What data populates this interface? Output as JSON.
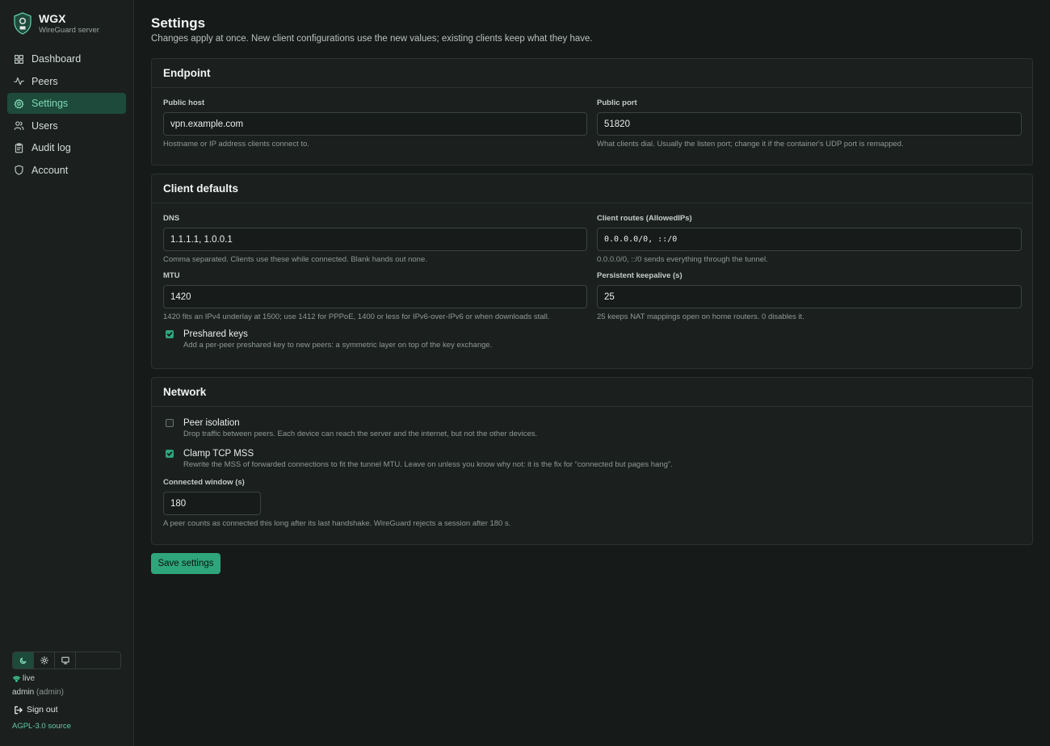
{
  "brand": {
    "name": "WGX",
    "subtitle": "WireGuard server",
    "logo_icon": "shield-lock-icon"
  },
  "sidebar": {
    "items": [
      {
        "label": "Dashboard",
        "icon": "grid-icon",
        "active": false
      },
      {
        "label": "Peers",
        "icon": "activity-icon",
        "active": false
      },
      {
        "label": "Settings",
        "icon": "gear-icon",
        "active": true
      },
      {
        "label": "Users",
        "icon": "users-icon",
        "active": false
      },
      {
        "label": "Audit log",
        "icon": "clipboard-icon",
        "active": false
      },
      {
        "label": "Account",
        "icon": "shield-icon",
        "active": false
      }
    ],
    "theme_options": [
      "dark",
      "light",
      "system"
    ],
    "theme_selected": "dark",
    "status": "live",
    "user_name": "admin",
    "user_role": "(admin)",
    "sign_out": "Sign out",
    "source_link": "AGPL-3.0 source"
  },
  "page": {
    "title": "Settings",
    "description": "Changes apply at once. New client configurations use the new values; existing clients keep what they have."
  },
  "endpoint": {
    "heading": "Endpoint",
    "public_host": {
      "label": "Public host",
      "value": "vpn.example.com",
      "hint": "Hostname or IP address clients connect to."
    },
    "public_port": {
      "label": "Public port",
      "value": "51820",
      "hint": "What clients dial. Usually the listen port; change it if the container's UDP port is remapped."
    }
  },
  "client_defaults": {
    "heading": "Client defaults",
    "dns": {
      "label": "DNS",
      "value": "1.1.1.1, 1.0.0.1",
      "hint": "Comma separated. Clients use these while connected. Blank hands out none."
    },
    "routes": {
      "label": "Client routes (AllowedIPs)",
      "value": "0.0.0.0/0, ::/0",
      "hint": "0.0.0.0/0, ::/0 sends everything through the tunnel."
    },
    "mtu": {
      "label": "MTU",
      "value": "1420",
      "hint": "1420 fits an IPv4 underlay at 1500; use 1412 for PPPoE, 1400 or less for IPv6-over-IPv6 or when downloads stall."
    },
    "keepalive": {
      "label": "Persistent keepalive (s)",
      "value": "25",
      "hint": "25 keeps NAT mappings open on home routers. 0 disables it."
    },
    "preshared": {
      "label": "Preshared keys",
      "checked": true,
      "hint": "Add a per-peer preshared key to new peers: a symmetric layer on top of the key exchange."
    }
  },
  "network": {
    "heading": "Network",
    "peer_isolation": {
      "label": "Peer isolation",
      "checked": false,
      "hint": "Drop traffic between peers. Each device can reach the server and the internet, but not the other devices."
    },
    "clamp_mss": {
      "label": "Clamp TCP MSS",
      "checked": true,
      "hint": "Rewrite the MSS of forwarded connections to fit the tunnel MTU. Leave on unless you know why not: it is the fix for “connected but pages hang”."
    },
    "connected_window": {
      "label": "Connected window (s)",
      "value": "180",
      "hint": "A peer counts as connected this long after its last handshake. WireGuard rejects a session after 180 s."
    }
  },
  "actions": {
    "save_label": "Save settings"
  },
  "colors": {
    "accent": "#2fa57c",
    "active_nav_bg": "#1d4a3b",
    "background": "#161a19",
    "panel": "#1b201f"
  }
}
